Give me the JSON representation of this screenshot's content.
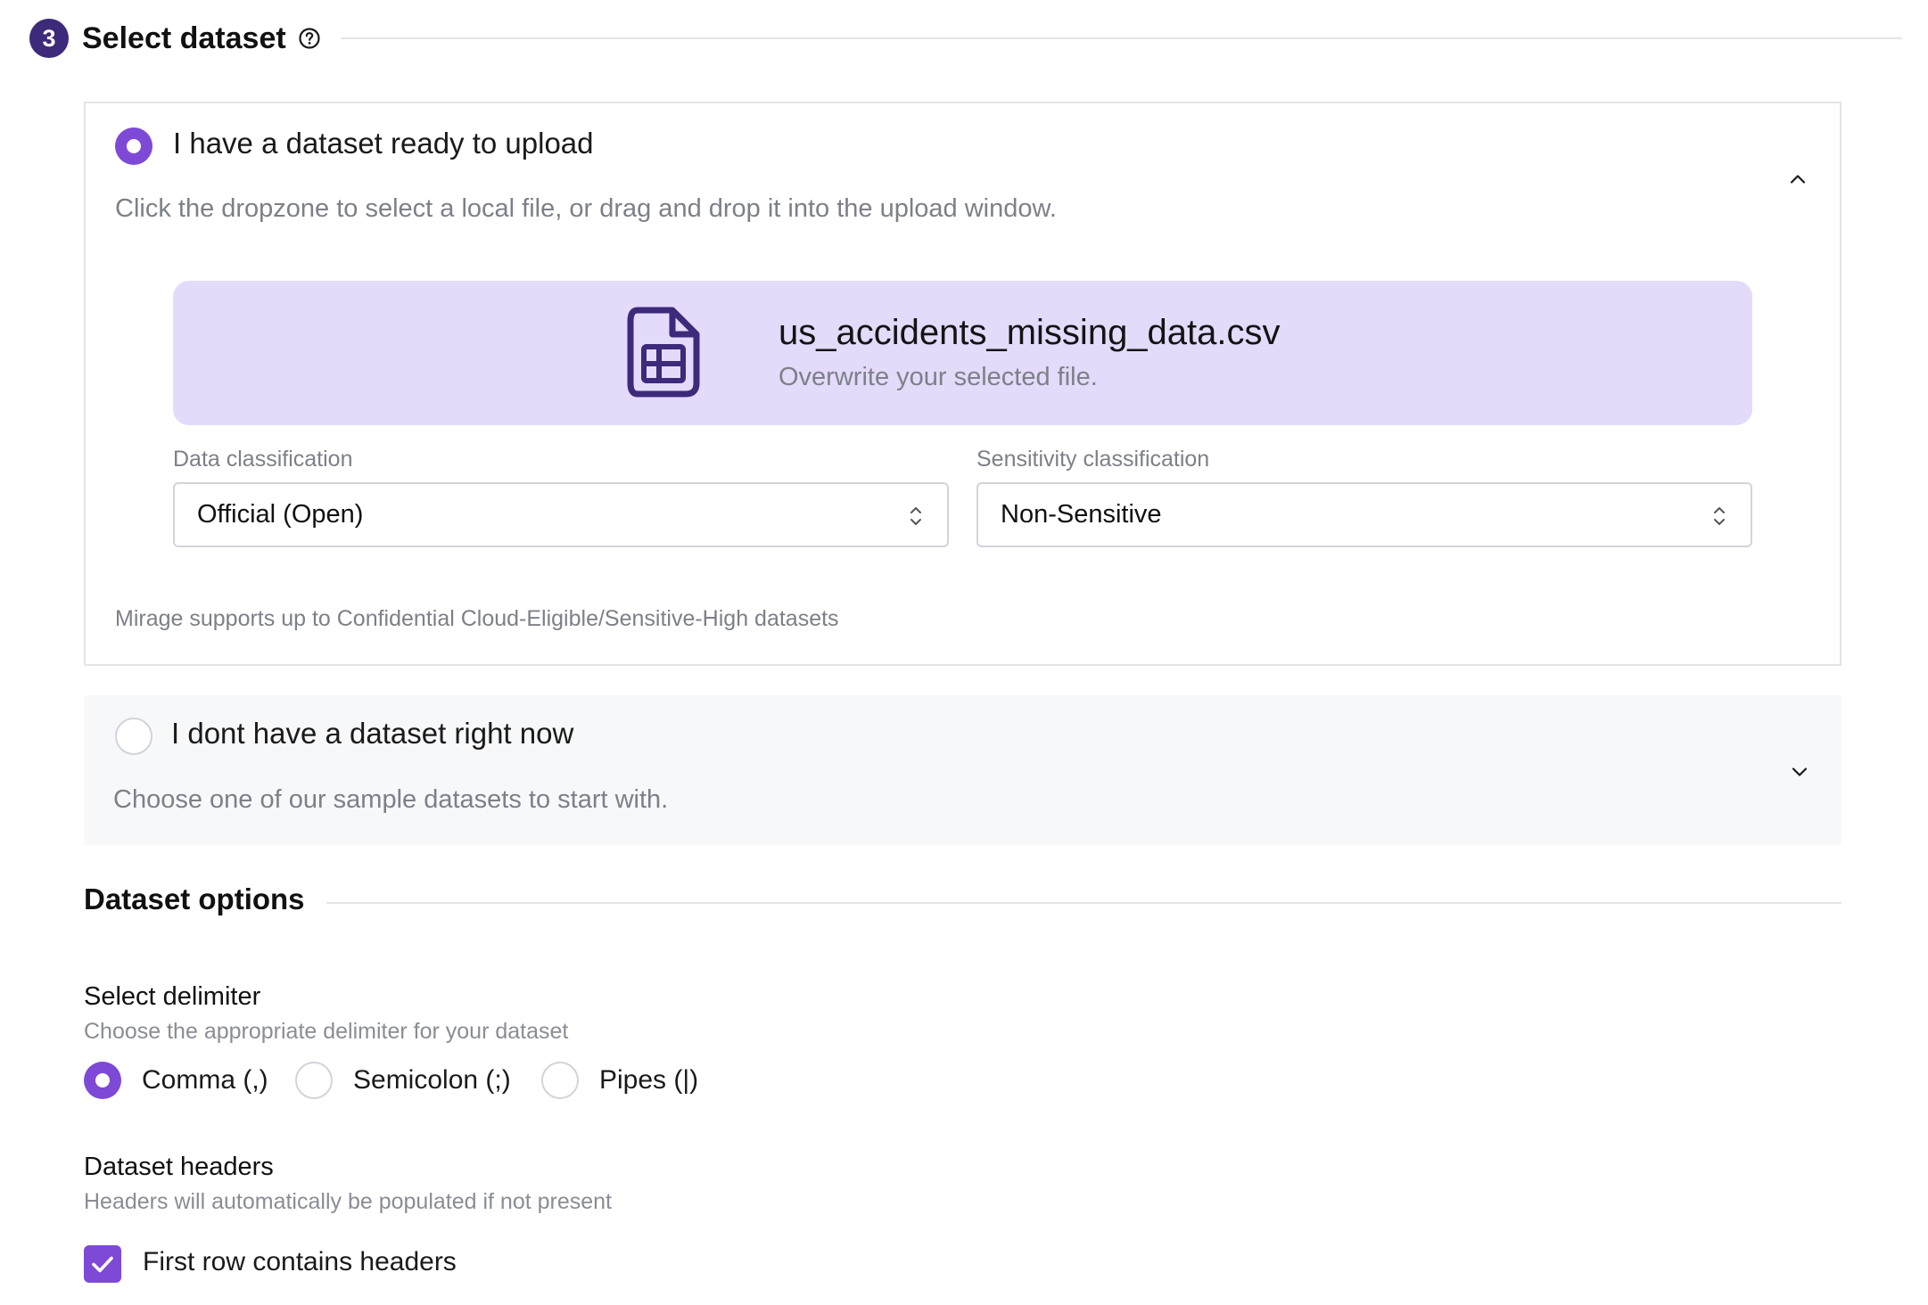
{
  "step": {
    "number": "3",
    "title": "Select dataset",
    "help_icon": "question-circle-icon"
  },
  "upload_option": {
    "title": "I have a dataset ready to upload",
    "description": "Click the dropzone to select a local file, or drag and drop it into the upload window.",
    "selected": true,
    "expanded": true,
    "dropzone": {
      "file_name": "us_accidents_missing_data.csv",
      "hint": "Overwrite your selected file.",
      "icon": "spreadsheet-file-icon"
    },
    "data_classification": {
      "label": "Data classification",
      "value": "Official (Open)"
    },
    "sensitivity_classification": {
      "label": "Sensitivity classification",
      "value": "Non-Sensitive"
    },
    "support_note": "Mirage supports up to Confidential Cloud-Eligible/Sensitive-High datasets"
  },
  "sample_option": {
    "title": "I dont have a dataset right now",
    "description": "Choose one of our sample datasets to start with.",
    "selected": false,
    "expanded": false
  },
  "dataset_options": {
    "title": "Dataset options",
    "delimiter": {
      "title": "Select delimiter",
      "description": "Choose the appropriate delimiter for your dataset",
      "options": [
        {
          "label": "Comma (,)",
          "selected": true
        },
        {
          "label": "Semicolon (;)",
          "selected": false
        },
        {
          "label": "Pipes (|)",
          "selected": false
        }
      ]
    },
    "headers": {
      "title": "Dataset headers",
      "description": "Headers will automatically be populated if not present",
      "checkbox_label": "First row contains headers",
      "checked": true
    }
  },
  "colors": {
    "accent": "#7e49d6",
    "step_badge": "#3d2a7a",
    "dropzone_bg": "#e4dafa",
    "muted_text": "#7d8088"
  }
}
